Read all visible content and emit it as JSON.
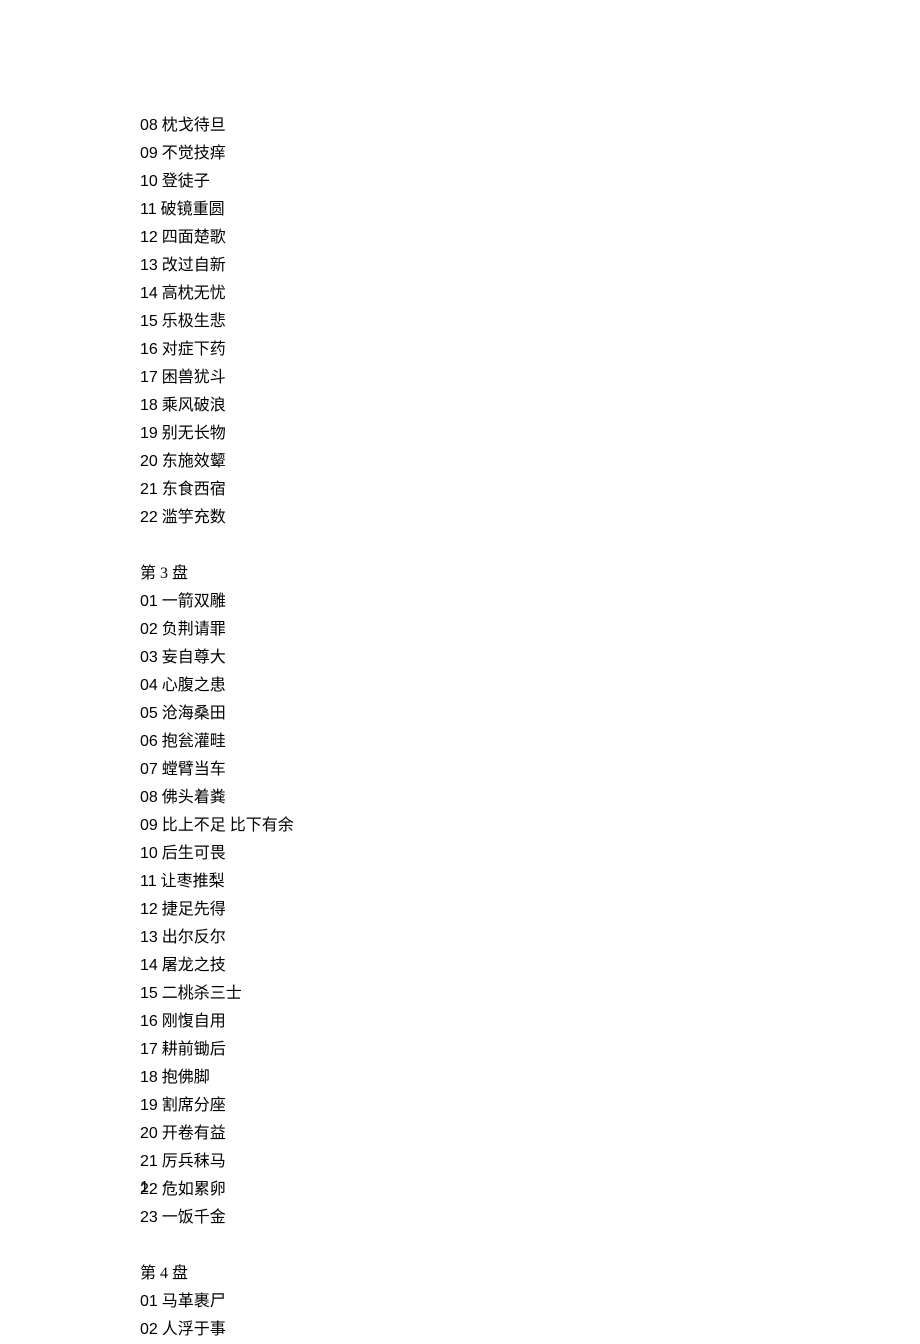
{
  "disc2_tail": [
    {
      "n": "08",
      "t": "枕戈待旦"
    },
    {
      "n": "09",
      "t": "不觉技痒"
    },
    {
      "n": "10",
      "t": "登徒子"
    },
    {
      "n": "11",
      "t": "破镜重圆"
    },
    {
      "n": "12",
      "t": "四面楚歌"
    },
    {
      "n": "13",
      "t": "改过自新"
    },
    {
      "n": "14",
      "t": "高枕无忧"
    },
    {
      "n": "15",
      "t": "乐极生悲"
    },
    {
      "n": "16",
      "t": "对症下药"
    },
    {
      "n": "17",
      "t": "困兽犹斗"
    },
    {
      "n": "18",
      "t": "乘风破浪"
    },
    {
      "n": "19",
      "t": "别无长物"
    },
    {
      "n": "20",
      "t": "东施效颦"
    },
    {
      "n": "21",
      "t": "东食西宿"
    },
    {
      "n": "22",
      "t": "滥竽充数"
    }
  ],
  "disc3_header": "第 3 盘",
  "disc3": [
    {
      "n": "01",
      "t": "一箭双雕"
    },
    {
      "n": "02",
      "t": "负荆请罪"
    },
    {
      "n": "03",
      "t": "妄自尊大"
    },
    {
      "n": "04",
      "t": "心腹之患"
    },
    {
      "n": "05",
      "t": "沧海桑田"
    },
    {
      "n": "06",
      "t": "抱瓮灌畦"
    },
    {
      "n": "07",
      "t": "螳臂当车"
    },
    {
      "n": "08",
      "t": "佛头着粪"
    },
    {
      "n": "09",
      "t": "比上不足 比下有余"
    },
    {
      "n": "10",
      "t": "后生可畏"
    },
    {
      "n": "11",
      "t": "让枣推梨"
    },
    {
      "n": "12",
      "t": "捷足先得"
    },
    {
      "n": "13",
      "t": "出尔反尔"
    },
    {
      "n": "14",
      "t": "屠龙之技"
    },
    {
      "n": "15",
      "t": "二桃杀三士"
    },
    {
      "n": "16",
      "t": "刚愎自用"
    },
    {
      "n": "17",
      "t": "耕前锄后"
    },
    {
      "n": "18",
      "t": "抱佛脚"
    },
    {
      "n": "19",
      "t": "割席分座"
    },
    {
      "n": "20",
      "t": "开卷有益"
    },
    {
      "n": "21",
      "t": "厉兵秣马"
    },
    {
      "n": "22",
      "t": "危如累卵"
    },
    {
      "n": "23",
      "t": "一饭千金"
    }
  ],
  "disc4_header": "第 4 盘",
  "disc4_head": [
    {
      "n": "01",
      "t": "马革裹尸"
    },
    {
      "n": "02",
      "t": "人浮于事"
    }
  ],
  "page_number": "1"
}
